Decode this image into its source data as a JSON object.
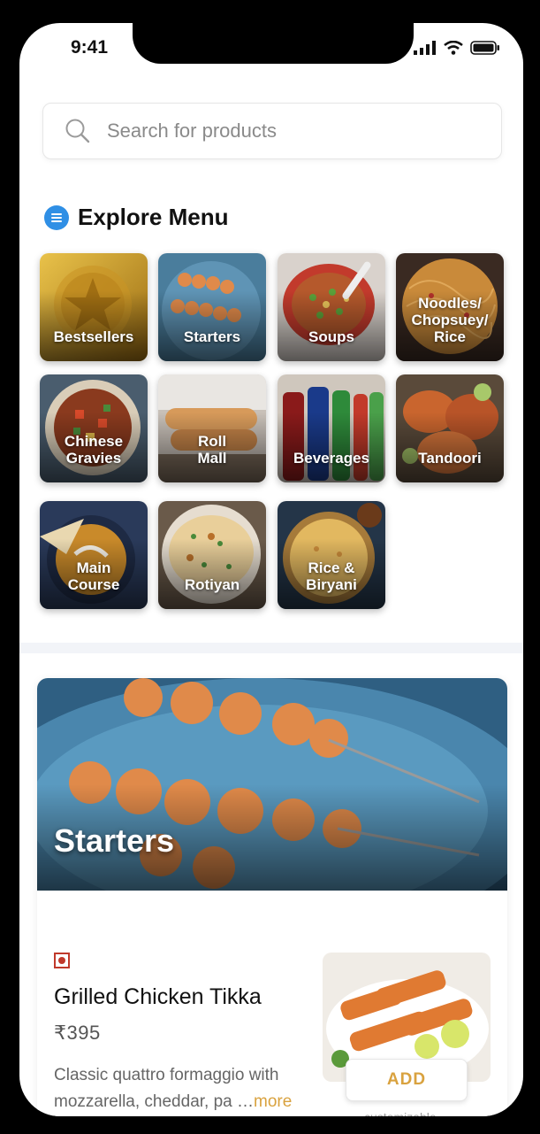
{
  "status_bar": {
    "time": "9:41"
  },
  "search": {
    "placeholder": "Search for products",
    "value": ""
  },
  "explore": {
    "title": "Explore Menu",
    "accent": "#2f8fe5",
    "categories": [
      {
        "label": "Bestsellers",
        "icon": "star-icon"
      },
      {
        "label": "Starters"
      },
      {
        "label": "Soups"
      },
      {
        "label": "Noodles/\nChopsuey/\nRice"
      },
      {
        "label": "Chinese\nGravies"
      },
      {
        "label": "Roll\nMall"
      },
      {
        "label": "Beverages"
      },
      {
        "label": "Tandoori"
      },
      {
        "label": "Main\nCourse"
      },
      {
        "label": "Rotiyan"
      },
      {
        "label": "Rice &\nBiryani"
      }
    ]
  },
  "section": {
    "title": "Starters",
    "item": {
      "name": "Grilled Chicken Tikka",
      "price": "₹395",
      "description": "Classic quattro formaggio with mozzarella, cheddar, pa …",
      "more_label": "more",
      "add_label": "ADD",
      "customizable_label": "customizable",
      "veg_mark_color": "#c0392b",
      "accent": "#d9a23f"
    }
  }
}
